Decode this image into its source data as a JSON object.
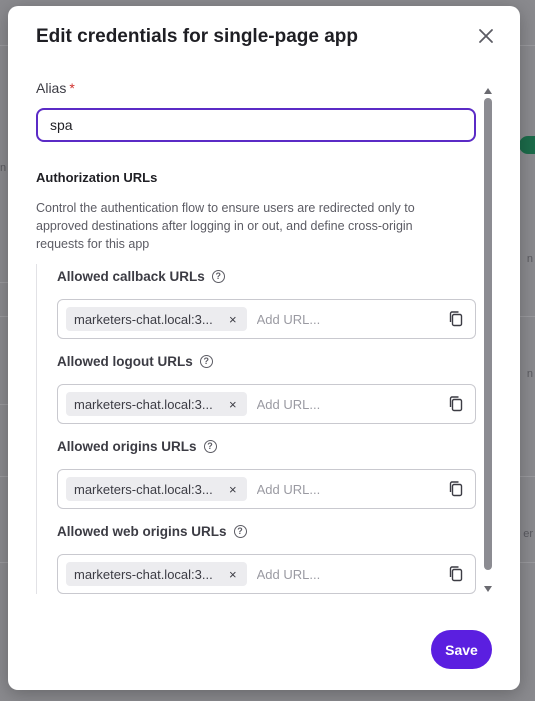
{
  "background": {
    "fragments": [
      "n",
      "n",
      "n",
      "er"
    ]
  },
  "modal": {
    "title": "Edit credentials for single-page app",
    "close_icon": "close-icon"
  },
  "alias": {
    "label": "Alias",
    "required_mark": "*",
    "value": "spa"
  },
  "authorization": {
    "title": "Authorization URLs",
    "description": "Control the authentication flow to ensure users are redirected only to approved destinations after logging in or out, and define cross-origin requests for this app"
  },
  "url_fields": [
    {
      "label": "Allowed callback URLs",
      "chip": "marketers-chat.local:3...",
      "placeholder": "Add URL..."
    },
    {
      "label": "Allowed logout URLs",
      "chip": "marketers-chat.local:3...",
      "placeholder": "Add URL..."
    },
    {
      "label": "Allowed origins URLs",
      "chip": "marketers-chat.local:3...",
      "placeholder": "Add URL..."
    },
    {
      "label": "Allowed web origins URLs",
      "chip": "marketers-chat.local:3...",
      "placeholder": "Add URL..."
    }
  ],
  "icons": {
    "help": "help-circle-icon",
    "copy": "copy-icon",
    "chip_remove": "×"
  },
  "footer": {
    "save_label": "Save"
  },
  "colors": {
    "accent": "#5b1fe0",
    "focus_border": "#5b2bc6",
    "required": "#d0312d"
  }
}
